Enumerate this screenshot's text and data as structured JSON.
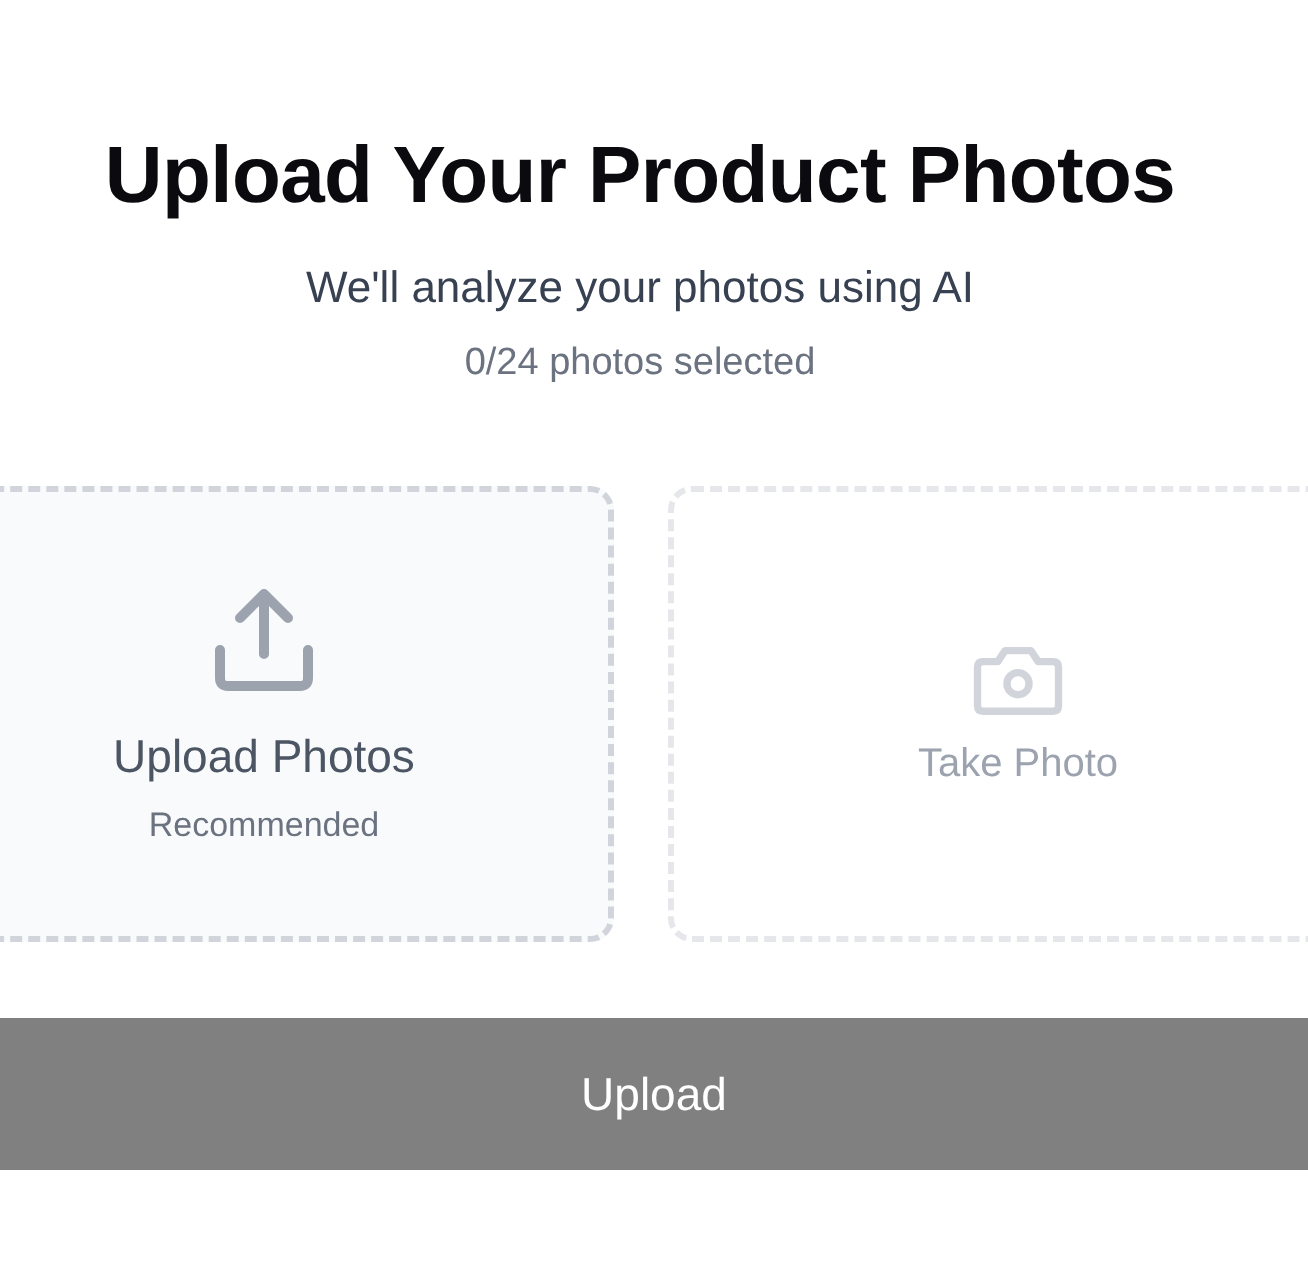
{
  "title": "Upload Your Product Photos",
  "subtitle": "We'll analyze your photos using AI",
  "count": "0/24 photos selected",
  "options": [
    {
      "kind": "upload",
      "label": "Upload Photos",
      "note": "Recommended",
      "disabled": false
    },
    {
      "kind": "camera",
      "label": "Take Photo",
      "disabled": true
    }
  ],
  "submit": {
    "label": "Upload",
    "disabled": true
  }
}
